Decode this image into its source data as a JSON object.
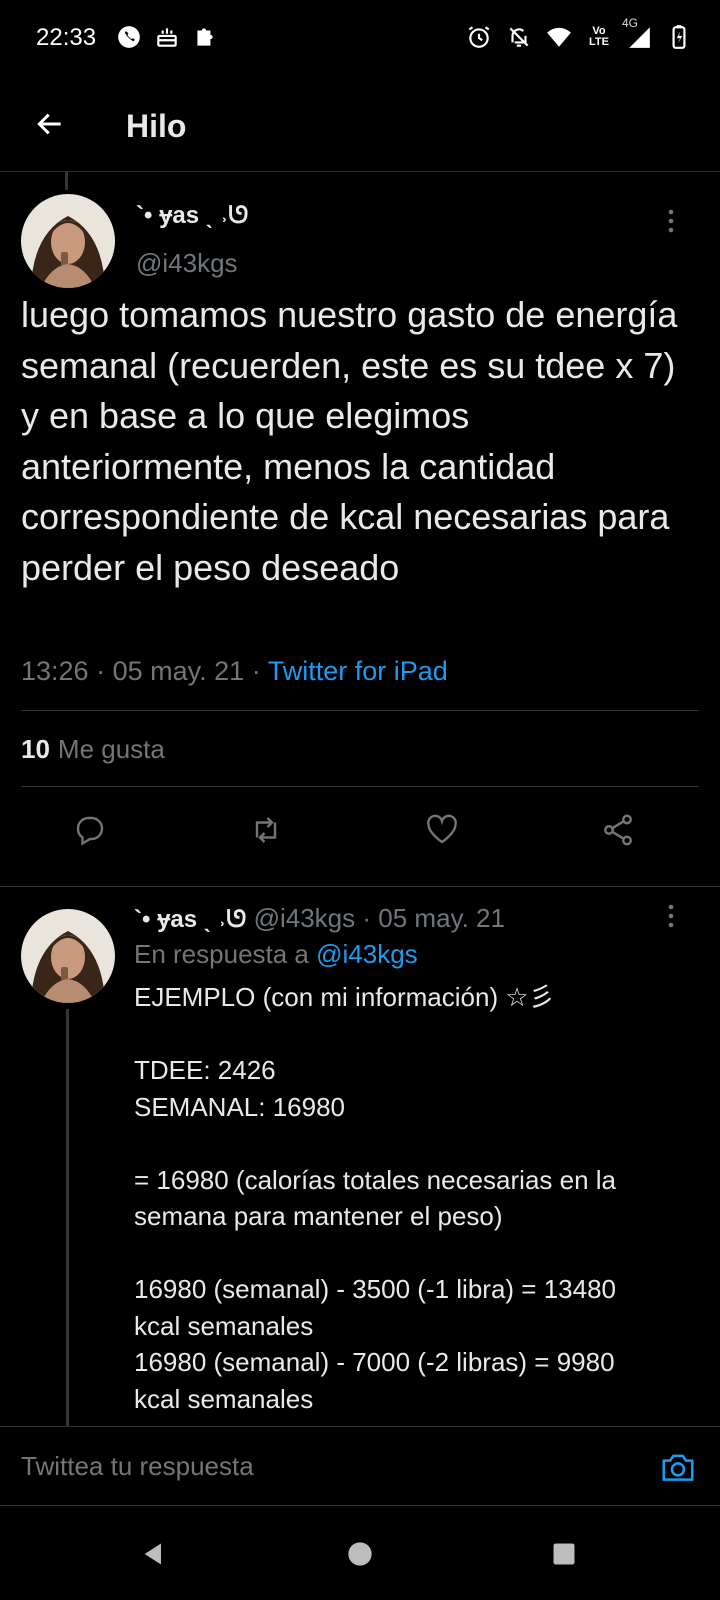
{
  "status_bar": {
    "time": "22:33",
    "network_label": "4G",
    "volte_label": "Vo LTE",
    "left_icons": [
      "whatsapp-icon",
      "cake-icon",
      "puzzle-icon"
    ],
    "right_icons": [
      "alarm-icon",
      "bell-off-icon",
      "wifi-icon",
      "volte-icon",
      "signal-icon",
      "battery-charging-icon"
    ]
  },
  "header": {
    "back_icon": "arrow-left-icon",
    "title": "Hilo"
  },
  "main_tweet": {
    "display_name": "`• ɏas ˎ ˒ᘎ",
    "handle": "@i43kgs",
    "text": "luego tomamos nuestro gasto de energía semanal (recuerden, este es su tdee x 7) y en base a lo que elegimos anteriormente, menos la cantidad correspondiente de kcal necesarias para perder el peso deseado",
    "time": "13:26",
    "date": "05 may. 21",
    "source": "Twitter for iPad",
    "likes_count": "10",
    "likes_label": "Me gusta",
    "actions": [
      "reply-icon",
      "retweet-icon",
      "like-icon",
      "share-icon"
    ]
  },
  "reply_tweet": {
    "display_name": "`• ɏas ˎ ˒ᘎ",
    "handle": "@i43kgs",
    "date": "05 may. 21",
    "in_reply_label": "En respuesta a",
    "in_reply_to": "@i43kgs",
    "lines": [
      "EJEMPLO (con mi información) ☆彡",
      "",
      "TDEE: 2426",
      "SEMANAL: 16980",
      "",
      "= 16980 (calorías totales necesarias en la",
      "semana para mantener el peso)",
      "",
      "16980 (semanal) - 3500 (-1 libra) = 13480",
      "kcal semanales",
      "16980 (semanal) - 7000 (-2 libras) = 9980",
      "kcal semanales"
    ]
  },
  "composer": {
    "placeholder": "Twittea tu respuesta",
    "camera_icon": "camera-icon"
  },
  "navbar": {
    "buttons": [
      "back-triangle-icon",
      "home-circle-icon",
      "recents-square-icon"
    ]
  },
  "colors": {
    "background": "#000000",
    "text": "#e7e9ea",
    "secondary": "#71767b",
    "accent": "#1d9bf0",
    "divider": "#2f3336"
  }
}
